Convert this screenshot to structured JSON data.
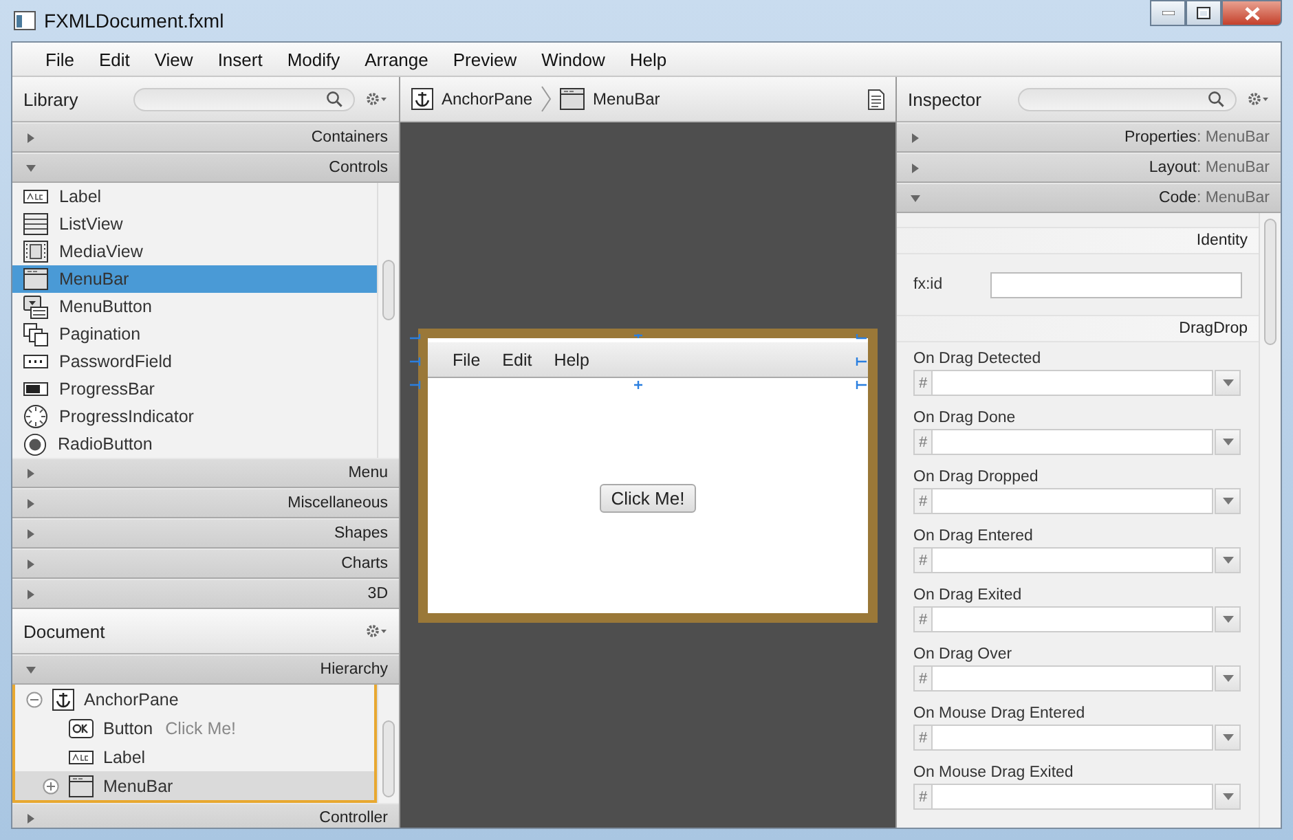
{
  "window": {
    "title": "FXMLDocument.fxml"
  },
  "menu": [
    "File",
    "Edit",
    "View",
    "Insert",
    "Modify",
    "Arrange",
    "Preview",
    "Window",
    "Help"
  ],
  "library": {
    "title": "Library",
    "sections": [
      {
        "title": "Containers",
        "expanded": false
      },
      {
        "title": "Controls",
        "expanded": true,
        "items": [
          {
            "label": "Label",
            "kind": "label",
            "selected": false
          },
          {
            "label": "ListView",
            "kind": "list",
            "selected": false
          },
          {
            "label": "MediaView",
            "kind": "media",
            "selected": false
          },
          {
            "label": "MenuBar",
            "kind": "window",
            "selected": true
          },
          {
            "label": "MenuButton",
            "kind": "menubutton",
            "selected": false
          },
          {
            "label": "Pagination",
            "kind": "pages",
            "selected": false
          },
          {
            "label": "PasswordField",
            "kind": "password",
            "selected": false
          },
          {
            "label": "ProgressBar",
            "kind": "progress",
            "selected": false
          },
          {
            "label": "ProgressIndicator",
            "kind": "dial",
            "selected": false
          },
          {
            "label": "RadioButton",
            "kind": "radio",
            "selected": false
          }
        ]
      },
      {
        "title": "Menu",
        "expanded": false
      },
      {
        "title": "Miscellaneous",
        "expanded": false
      },
      {
        "title": "Shapes",
        "expanded": false
      },
      {
        "title": "Charts",
        "expanded": false
      },
      {
        "title": "3D",
        "expanded": false
      }
    ]
  },
  "document": {
    "title": "Document",
    "sections": [
      {
        "title": "Hierarchy",
        "expanded": true,
        "tree": [
          {
            "label": "AnchorPane",
            "kind": "anchor",
            "expanded": true,
            "selected": false,
            "children": [
              {
                "label": "Button",
                "note": "Click Me!",
                "kind": "ok",
                "selected": false
              },
              {
                "label": "Label",
                "kind": "label",
                "selected": false
              },
              {
                "label": "MenuBar",
                "kind": "window",
                "expanded": false,
                "selected": true
              }
            ]
          }
        ]
      },
      {
        "title": "Controller",
        "expanded": false
      }
    ]
  },
  "breadcrumb": [
    {
      "label": "AnchorPane",
      "kind": "anchor"
    },
    {
      "label": "MenuBar",
      "kind": "window"
    }
  ],
  "canvas": {
    "menus": [
      "File",
      "Edit",
      "Help"
    ],
    "button": "Click Me!"
  },
  "inspector": {
    "title": "Inspector",
    "sections": [
      {
        "title": "Properties",
        "separator": ":",
        "target": "MenuBar",
        "expanded": false
      },
      {
        "title": "Layout",
        "separator": ":",
        "target": "MenuBar",
        "expanded": false
      },
      {
        "title": "Code",
        "separator": ":",
        "target": "MenuBar",
        "expanded": true
      }
    ],
    "groups": [
      {
        "title": "Identity",
        "fields": [
          {
            "kind": "text",
            "label": "fx:id"
          }
        ]
      },
      {
        "title": "DragDrop",
        "fields": [
          {
            "kind": "handler",
            "label": "On Drag Detected",
            "prefix": "#"
          },
          {
            "kind": "handler",
            "label": "On Drag Done",
            "prefix": "#"
          },
          {
            "kind": "handler",
            "label": "On Drag Dropped",
            "prefix": "#"
          },
          {
            "kind": "handler",
            "label": "On Drag Entered",
            "prefix": "#"
          },
          {
            "kind": "handler",
            "label": "On Drag Exited",
            "prefix": "#"
          },
          {
            "kind": "handler",
            "label": "On Drag Over",
            "prefix": "#"
          },
          {
            "kind": "handler",
            "label": "On Mouse Drag Entered",
            "prefix": "#"
          },
          {
            "kind": "handler",
            "label": "On Mouse Drag Exited",
            "prefix": "#"
          }
        ]
      }
    ]
  }
}
